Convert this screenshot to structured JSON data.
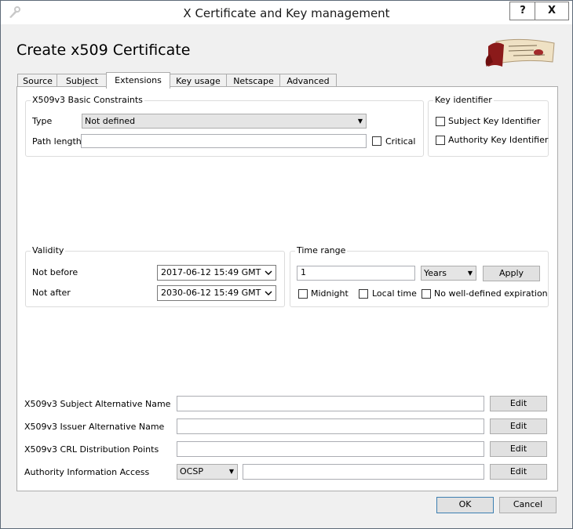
{
  "window": {
    "title": "X Certificate and Key management",
    "help_label": "?",
    "close_label": "X"
  },
  "heading": "Create x509 Certificate",
  "tabs": [
    {
      "label": "Source"
    },
    {
      "label": "Subject"
    },
    {
      "label": "Extensions",
      "active": true
    },
    {
      "label": "Key usage"
    },
    {
      "label": "Netscape"
    },
    {
      "label": "Advanced"
    }
  ],
  "basic_constraints": {
    "title": "X509v3 Basic Constraints",
    "type_label": "Type",
    "type_value": "Not defined",
    "path_length_label": "Path length",
    "path_length_value": "",
    "critical_label": "Critical"
  },
  "key_identifier": {
    "title": "Key identifier",
    "subject_label": "Subject Key Identifier",
    "authority_label": "Authority Key Identifier"
  },
  "validity": {
    "title": "Validity",
    "not_before_label": "Not before",
    "not_before_value": "2017-06-12 15:49 GMT",
    "not_after_label": "Not after",
    "not_after_value": "2030-06-12 15:49 GMT"
  },
  "time_range": {
    "title": "Time range",
    "amount": "1",
    "unit": "Years",
    "apply_label": "Apply",
    "midnight_label": "Midnight",
    "local_time_label": "Local time",
    "no_expiration_label": "No well-defined expiration"
  },
  "extensions": {
    "san_label": "X509v3 Subject Alternative Name",
    "ian_label": "X509v3 Issuer Alternative Name",
    "crl_label": "X509v3 CRL Distribution Points",
    "aia_label": "Authority Information Access",
    "aia_method": "OCSP",
    "edit_label": "Edit"
  },
  "footer": {
    "ok_label": "OK",
    "cancel_label": "Cancel"
  },
  "colors": {
    "window_border": "#5e6a78",
    "dialog_background": "#f0f0f0",
    "logo_red": "#8b1a1a"
  },
  "icons": [
    "app-icon",
    "help-icon",
    "close-icon",
    "logo-scroll-icon",
    "combo-arrow-icon",
    "chevron-down-icon"
  ]
}
